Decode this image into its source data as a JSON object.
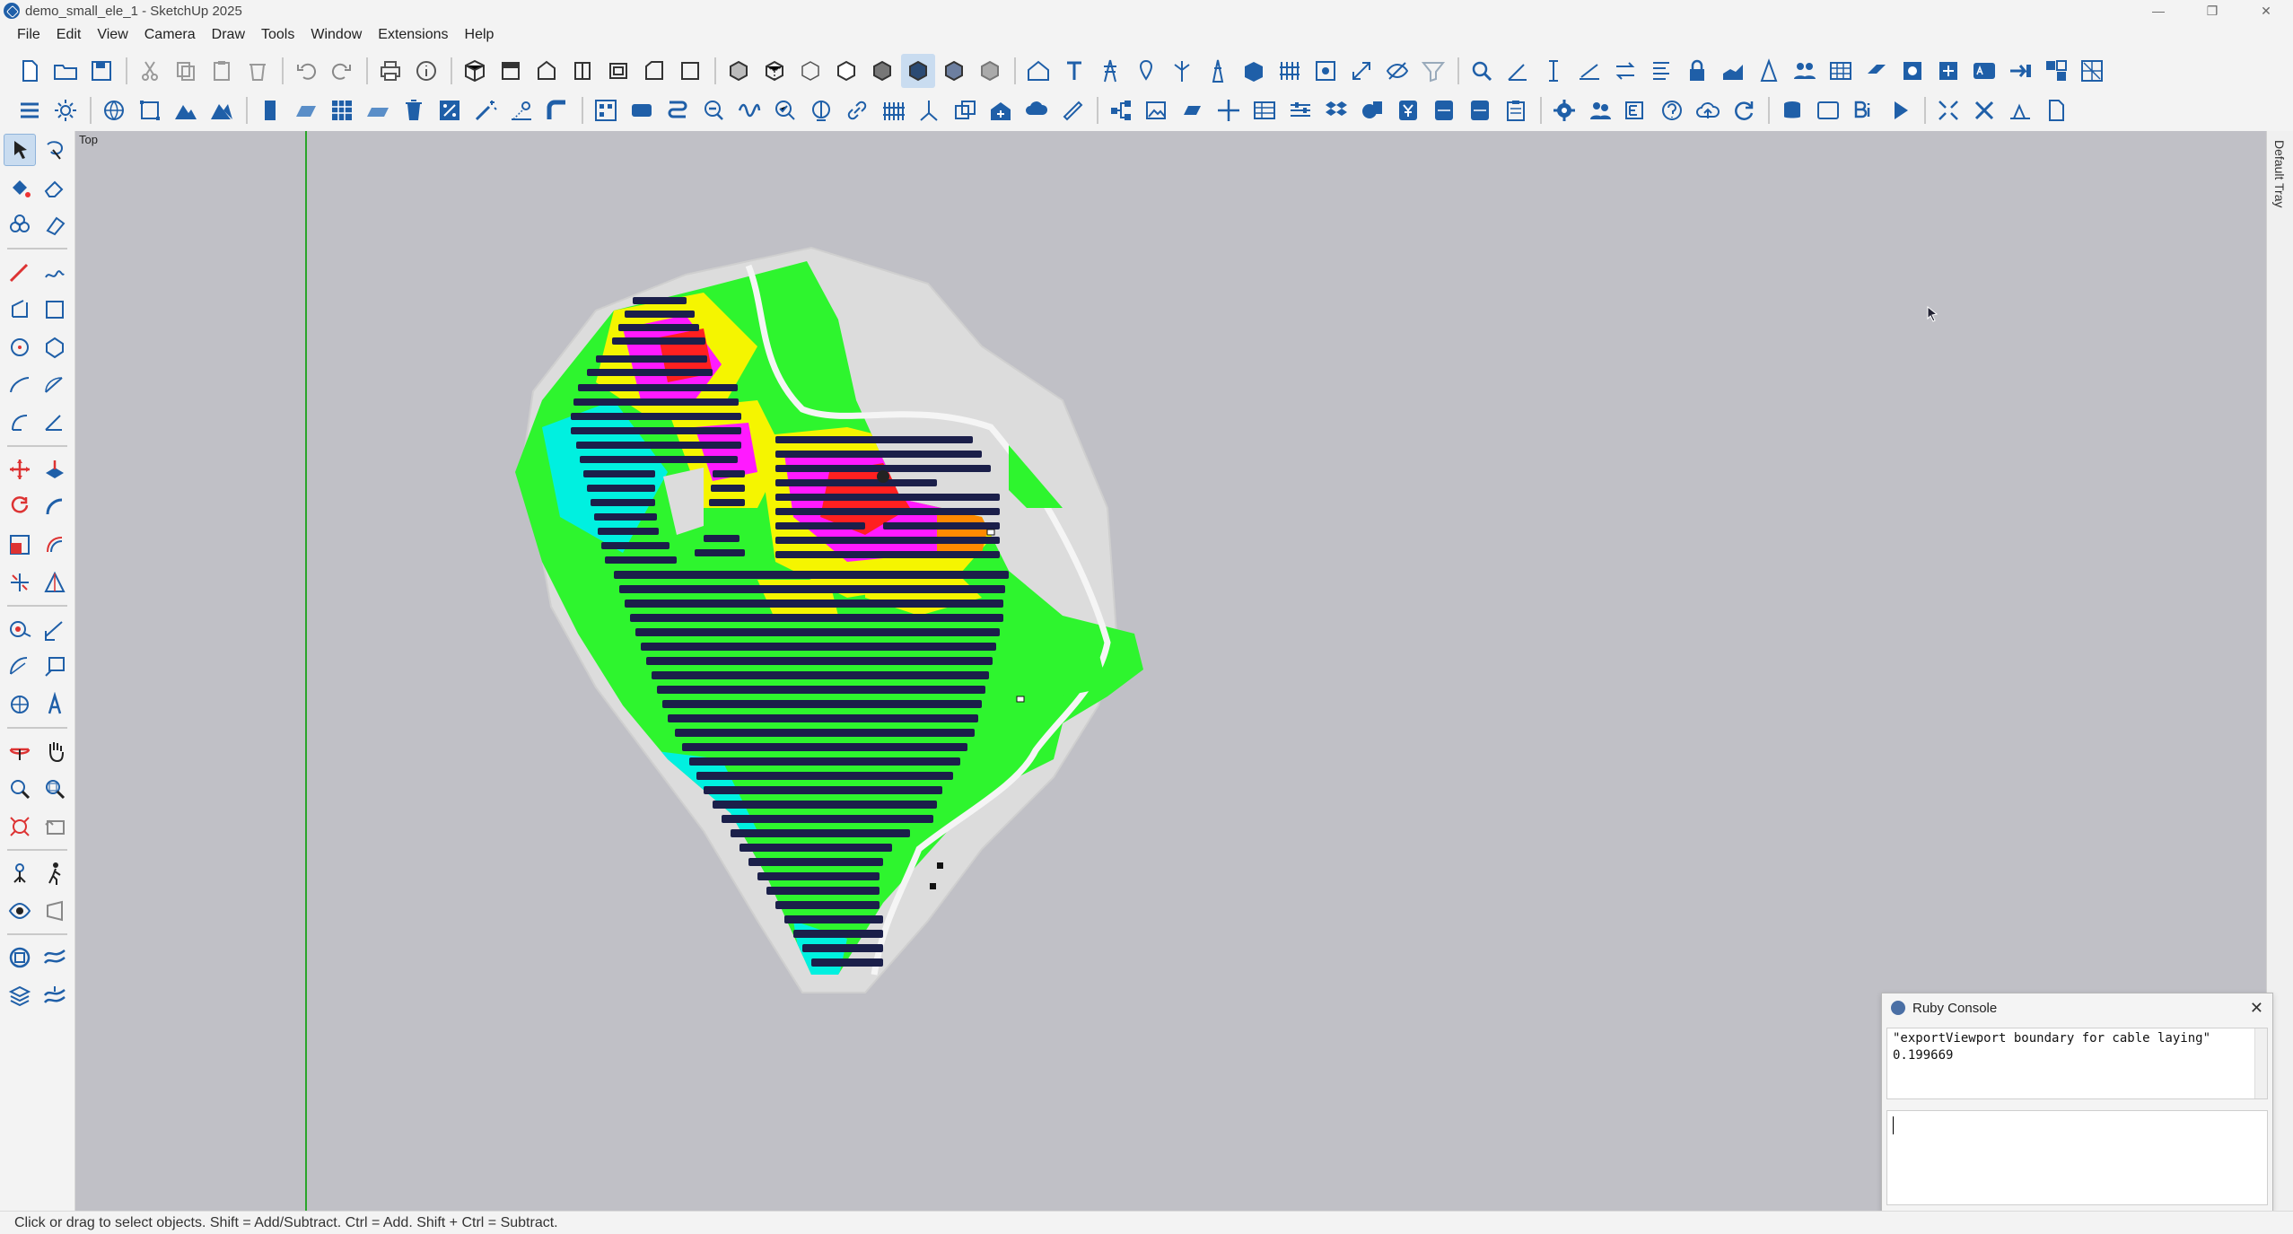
{
  "window": {
    "title": "demo_small_ele_1 - SketchUp 2025",
    "controls": [
      "minimize",
      "restore",
      "close"
    ]
  },
  "menu": [
    "File",
    "Edit",
    "View",
    "Camera",
    "Draw",
    "Tools",
    "Window",
    "Extensions",
    "Help"
  ],
  "viewport": {
    "view_label": "Top"
  },
  "tray": {
    "label": "Default Tray"
  },
  "ruby_console": {
    "title": "Ruby Console",
    "output_lines": [
      "\"exportViewport boundary for cable laying\"",
      "0.199669"
    ],
    "input_value": ""
  },
  "status": {
    "text": "Click or drag to select objects. Shift = Add/Subtract. Ctrl = Add. Shift + Ctrl = Subtract."
  },
  "colors": {
    "ui_blue": "#1f5fa8",
    "viewport_bg": "#c0c0c6",
    "panel_dark": "#1b1f4a",
    "terrain_green": "#2ef52e",
    "terrain_cyan": "#00f0e0",
    "terrain_yellow": "#f5f500",
    "terrain_magenta": "#ff1aff",
    "terrain_red": "#ff2020",
    "green_axis": "#2aa52a"
  }
}
